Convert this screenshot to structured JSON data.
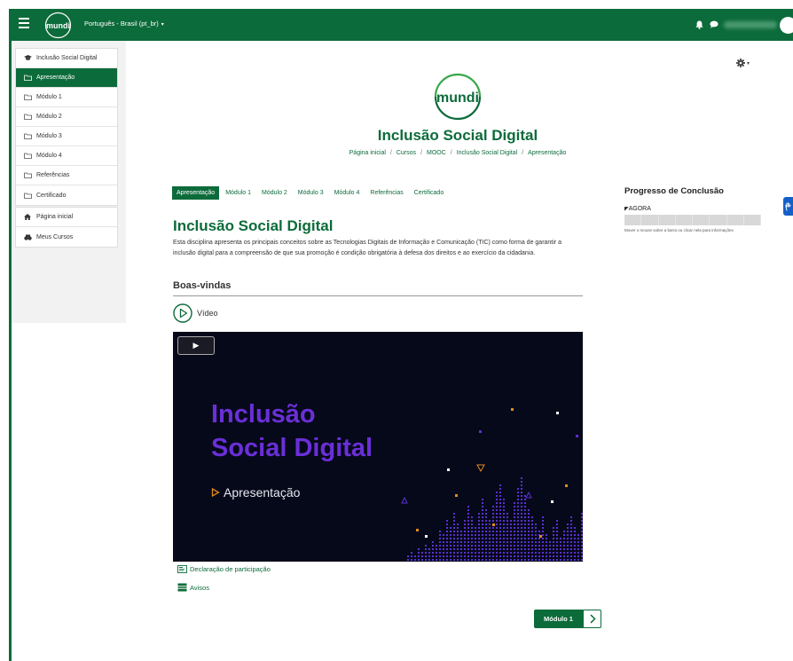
{
  "navbar": {
    "logo_text": "mundi",
    "language": "Português - Brasil (pt_br)",
    "language_caret": "▾"
  },
  "drawer": {
    "items": [
      {
        "label": "Inclusão Social Digital",
        "icon": "graduation-cap-icon"
      },
      {
        "label": "Apresentação",
        "icon": "folder-icon",
        "active": true
      },
      {
        "label": "Módulo 1",
        "icon": "folder-icon"
      },
      {
        "label": "Módulo 2",
        "icon": "folder-icon"
      },
      {
        "label": "Módulo 3",
        "icon": "folder-icon"
      },
      {
        "label": "Módulo 4",
        "icon": "folder-icon"
      },
      {
        "label": "Referências",
        "icon": "folder-icon"
      },
      {
        "label": "Certificado",
        "icon": "folder-icon"
      }
    ],
    "nav_items": [
      {
        "label": "Página inicial",
        "icon": "home-icon"
      },
      {
        "label": "Meus Cursos",
        "icon": "courses-icon"
      }
    ]
  },
  "header": {
    "logo_text": "mundi",
    "course_title": "Inclusão Social Digital",
    "breadcrumb": [
      "Página inicial",
      "Cursos",
      "MOOC",
      "Inclusão Social Digital",
      "Apresentação"
    ],
    "breadcrumb_sep": "/"
  },
  "tabs": [
    {
      "label": "Apresentação",
      "active": true
    },
    {
      "label": "Módulo 1"
    },
    {
      "label": "Módulo 2"
    },
    {
      "label": "Módulo 3"
    },
    {
      "label": "Módulo 4"
    },
    {
      "label": "Referências"
    },
    {
      "label": "Certificado"
    }
  ],
  "section": {
    "title": "Inclusão Social Digital",
    "summary": "Esta disciplina apresenta os principais conceitos sobre as Tecnologias Digitais de Informação e Comunicação (TIC) como forma de garantir a inclusão digital para a compreensão de que sua promoção é condição obrigatória à defesa dos direitos e ao exercício da cidadania.",
    "subsection_title": "Boas-vindas",
    "video_label": "Vídeo"
  },
  "video": {
    "title_line1": "Inclusão",
    "title_line2": "Social Digital",
    "subtitle": "Apresentação",
    "play_glyph": "▶",
    "colors": {
      "background": "#06091a",
      "title": "#6a2fd8",
      "dots": "#5b2fd0",
      "accent": "#e08a1e"
    }
  },
  "links": [
    {
      "label": "Declaração de participação",
      "icon": "certificate-icon"
    },
    {
      "label": "Avisos",
      "icon": "forum-icon"
    }
  ],
  "next_button": {
    "label": "Módulo 1",
    "arrow": "›"
  },
  "completion": {
    "title": "Progresso de Conclusão",
    "now_label": "AGORA",
    "hint": "Mover o mouse sobre a barra ou clicar nela para informações",
    "progress": 0
  },
  "colors": {
    "brand": "#0c6b3a",
    "accessibility": "#1560c8"
  }
}
